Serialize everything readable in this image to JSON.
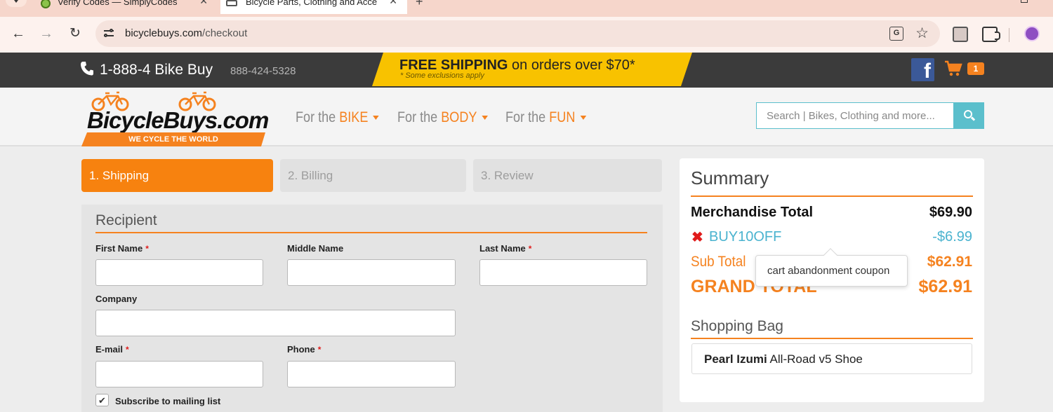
{
  "browser": {
    "tabs": [
      {
        "title": "Verify Codes — SimplyCodes",
        "active": false
      },
      {
        "title": "Bicycle Parts, Clothing and Acce",
        "active": true
      }
    ],
    "url_host": "bicyclebuys.com",
    "url_path": "/checkout"
  },
  "topbar": {
    "phone_main": "1-888-4 Bike Buy",
    "phone_number": "888-424-5328",
    "shipping_bold": "FREE SHIPPING",
    "shipping_rest": " on orders over $70*",
    "shipping_note": "* Some exclusions apply",
    "cart_count": "1",
    "accent_color": "#f5821f",
    "banner_color": "#f8c200"
  },
  "header": {
    "logo_text": "BicycleBuys.com",
    "logo_tagline": "WE CYCLE THE WORLD",
    "nav": [
      {
        "prefix": "For the ",
        "highlight": "BIKE"
      },
      {
        "prefix": "For the ",
        "highlight": "BODY"
      },
      {
        "prefix": "For the ",
        "highlight": "FUN"
      }
    ],
    "search_placeholder": "Search | Bikes, Clothing and more..."
  },
  "steps": [
    {
      "label": "1. Shipping",
      "active": true
    },
    {
      "label": "2. Billing",
      "active": false
    },
    {
      "label": "3. Review",
      "active": false
    }
  ],
  "form": {
    "section_title": "Recipient",
    "fields": {
      "first_name": {
        "label": "First Name",
        "required": true,
        "value": ""
      },
      "middle_name": {
        "label": "Middle Name",
        "required": false,
        "value": ""
      },
      "last_name": {
        "label": "Last Name",
        "required": true,
        "value": ""
      },
      "company": {
        "label": "Company",
        "required": false,
        "value": ""
      },
      "email": {
        "label": "E-mail",
        "required": true,
        "value": ""
      },
      "phone": {
        "label": "Phone",
        "required": true,
        "value": ""
      }
    },
    "required_mark": "*",
    "subscribe_label": "Subscribe to mailing list",
    "subscribe_checked": true
  },
  "summary": {
    "title": "Summary",
    "merchandise_label": "Merchandise Total",
    "merchandise_value": "$69.90",
    "coupon_code": "BUY10OFF",
    "coupon_value": "-$6.99",
    "subtotal_label": "Sub Total",
    "subtotal_value": "$62.91",
    "grand_label": "GRAND TOTAL",
    "grand_value": "$62.91",
    "coupon_tooltip": "cart abandonment coupon",
    "bag_title": "Shopping Bag",
    "bag_items": [
      {
        "brand": "Pearl Izumi",
        "name": " All-Road v5 Shoe"
      }
    ]
  }
}
